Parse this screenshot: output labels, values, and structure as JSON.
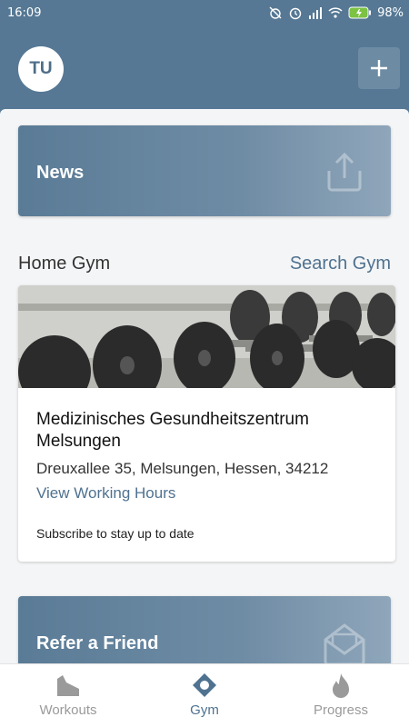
{
  "status": {
    "time": "16:09",
    "battery": "98%"
  },
  "header": {
    "avatar_initials": "TU",
    "add_label": "+"
  },
  "news": {
    "label": "News",
    "icon": "share-upload-icon"
  },
  "home_gym": {
    "title": "Home Gym",
    "search_link": "Search Gym",
    "name": "Medizinisches Gesundheitszentrum Melsungen",
    "address": "Dreuxallee 35, Melsungen, Hessen, 34212",
    "hours_link": "View Working Hours",
    "subscribe_text": "Subscribe to stay up to date"
  },
  "refer": {
    "label": "Refer a Friend",
    "icon": "envelope-open-icon"
  },
  "nav": [
    {
      "label": "Workouts",
      "icon": "shoe-icon",
      "active": false
    },
    {
      "label": "Gym",
      "icon": "location-pin-icon",
      "active": true
    },
    {
      "label": "Progress",
      "icon": "flame-icon",
      "active": false
    }
  ],
  "colors": {
    "brand": "#567894",
    "accent_text": "#4f7290",
    "inactive": "#9a9a9a"
  }
}
